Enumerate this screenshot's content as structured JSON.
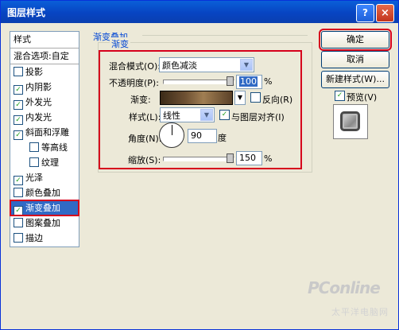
{
  "window": {
    "title": "图层样式",
    "help_label": "?",
    "close_label": "×"
  },
  "sidebar": {
    "header": "样式",
    "blend_options": "混合选项:自定",
    "items": [
      {
        "label": "投影",
        "checked": false
      },
      {
        "label": "内阴影",
        "checked": true
      },
      {
        "label": "外发光",
        "checked": true
      },
      {
        "label": "内发光",
        "checked": true
      },
      {
        "label": "斜面和浮雕",
        "checked": true
      },
      {
        "label": "等高线",
        "checked": false
      },
      {
        "label": "纹理",
        "checked": false
      },
      {
        "label": "光泽",
        "checked": true
      },
      {
        "label": "颜色叠加",
        "checked": false
      },
      {
        "label": "渐变叠加",
        "checked": true
      },
      {
        "label": "图案叠加",
        "checked": false
      },
      {
        "label": "描边",
        "checked": false
      }
    ]
  },
  "panel": {
    "section_title": "渐变叠加",
    "group_title": "渐变",
    "blend_mode_label": "混合模式(O):",
    "blend_mode_value": "颜色减淡",
    "opacity_label": "不透明度(P):",
    "opacity_value": "100",
    "opacity_unit": "%",
    "opacity_level": 1.0,
    "gradient_label": "渐变:",
    "reverse_label": "反向(R)",
    "reverse_checked": false,
    "style_label": "样式(L):",
    "style_value": "线性",
    "align_label": "与图层对齐(I)",
    "align_checked": true,
    "angle_label": "角度(N):",
    "angle_value": "90",
    "angle_unit": "度",
    "scale_label": "缩放(S):",
    "scale_value": "150",
    "scale_unit": "%",
    "scale_level": 1.0
  },
  "buttons": {
    "ok": "确定",
    "cancel": "取消",
    "new_style": "新建样式(W)...",
    "preview_label": "预览(V)",
    "preview_checked": true
  },
  "watermark": {
    "brand": "PConline",
    "sub": "太平洋电脑网"
  }
}
